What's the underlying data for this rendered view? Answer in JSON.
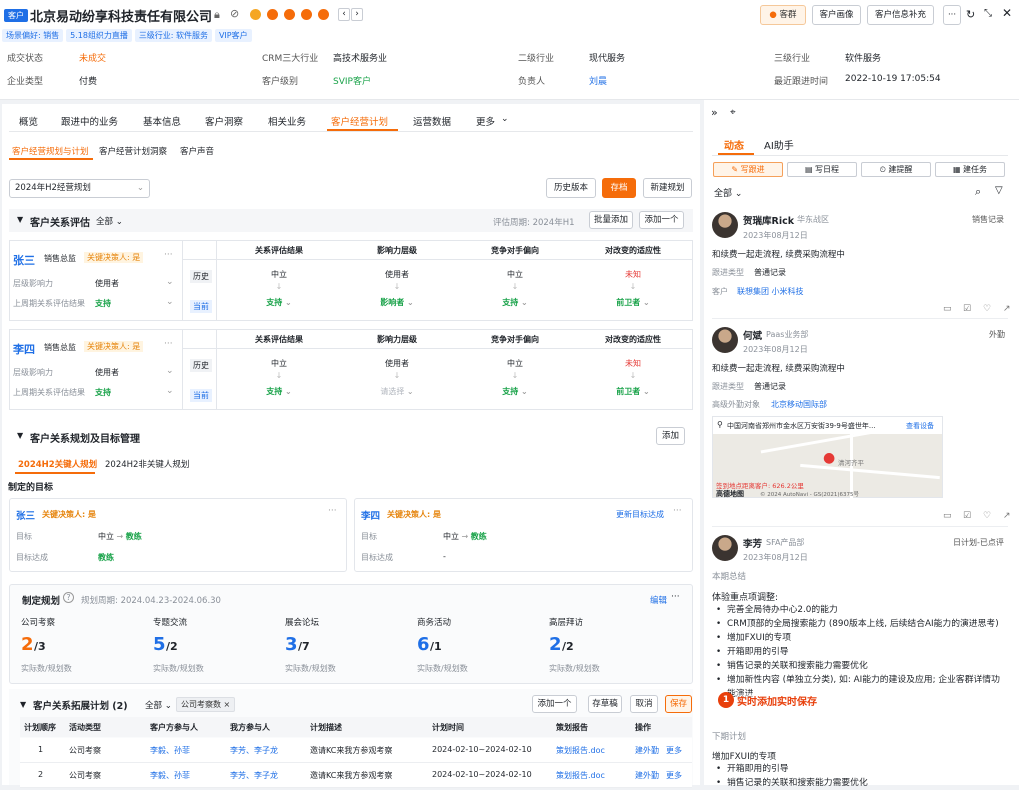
{
  "header": {
    "badge": "客户",
    "title": "北京易动纷享科技责任有限公司",
    "tags": [
      "场景偏好: 销售",
      "5.18组织力直播",
      "三级行业: 软件服务",
      "VIP客户"
    ],
    "btn_group": "客群",
    "btn_portrait": "客户画像",
    "btn_supplement": "客户信息补充"
  },
  "info": [
    {
      "label": "成交状态",
      "value": "未成交",
      "cls": "orange"
    },
    {
      "label": "CRM三大行业",
      "value": "高技术服务业",
      "cls": ""
    },
    {
      "label": "二级行业",
      "value": "现代服务",
      "cls": ""
    },
    {
      "label": "三级行业",
      "value": "软件服务",
      "cls": ""
    },
    {
      "label": "企业类型",
      "value": "付费",
      "cls": ""
    },
    {
      "label": "客户级别",
      "value": "SVIP客户",
      "cls": "green"
    },
    {
      "label": "负责人",
      "value": "刘晨",
      "cls": "blue"
    },
    {
      "label": "最近跟进时间",
      "value": "2022-10-19 17:05:54",
      "cls": ""
    }
  ],
  "tabs": [
    "概览",
    "跟进中的业务",
    "基本信息",
    "客户洞察",
    "相关业务",
    "客户经营计划",
    "运营数据",
    "更多"
  ],
  "subtabs": [
    "客户经营规划与计划",
    "客户经营计划洞察",
    "客户声音"
  ],
  "plan_select": "2024年H2经营规划",
  "toolbar": {
    "history": "历史版本",
    "save": "存档",
    "new": "新建规划"
  },
  "eval": {
    "title": "客户关系评估",
    "filter": "全部",
    "period": "评估周期: 2024年H1",
    "batch": "批量添加",
    "add": "添加一个",
    "cols": [
      "关系评估结果",
      "影响力层级",
      "竞争对手偏向",
      "对改变的适应性"
    ],
    "rows": [
      {
        "name": "张三",
        "role": "销售总监",
        "key": "关键决策人: 是",
        "f1": "层级影响力",
        "v1": "使用者",
        "f2": "上周期关系评估结果",
        "v2": "支持",
        "hist": [
          "中立",
          "使用者",
          "中立",
          "未知"
        ],
        "cur": [
          "支持",
          "影响者",
          "支持",
          "前卫者"
        ]
      },
      {
        "name": "李四",
        "role": "销售总监",
        "key": "关键决策人: 是",
        "f1": "层级影响力",
        "v1": "使用者",
        "f2": "上周期关系评估结果",
        "v2": "支持",
        "hist": [
          "中立",
          "使用者",
          "中立",
          "未知"
        ],
        "cur": [
          "支持",
          "请选择",
          "支持",
          "前卫者"
        ]
      }
    ],
    "hist_label": "历史",
    "cur_label": "当前"
  },
  "mgmt": {
    "title": "客户关系规划及目标管理",
    "add": "添加",
    "tab1": "2024H2关键人规划",
    "tab2": "2024H2非关键人规划",
    "goal_title": "制定的目标",
    "goals": [
      {
        "name": "张三",
        "key": "关键决策人: 是",
        "l1": "目标",
        "v1a": "中立",
        "v1b": "教练",
        "l2": "目标达成",
        "v2": "教练",
        "update": ""
      },
      {
        "name": "李四",
        "key": "关键决策人: 是",
        "l1": "目标",
        "v1a": "中立",
        "v1b": "教练",
        "l2": "目标达成",
        "v2": "-",
        "update": "更新目标达成"
      }
    ]
  },
  "plan": {
    "title": "制定规划",
    "period": "规划周期: 2024.04.23-2024.06.30",
    "edit": "编辑",
    "sub": "实际数/规划数",
    "stats": [
      {
        "label": "公司考察",
        "a": "2",
        "b": "/3",
        "c": "#f56c0a"
      },
      {
        "label": "专题交流",
        "a": "5",
        "b": "/2",
        "c": "#1f6fe6"
      },
      {
        "label": "展会论坛",
        "a": "3",
        "b": "/7",
        "c": "#1f6fe6"
      },
      {
        "label": "商务活动",
        "a": "6",
        "b": "/1",
        "c": "#1f6fe6"
      },
      {
        "label": "高层拜访",
        "a": "2",
        "b": "/2",
        "c": "#1f6fe6"
      }
    ]
  },
  "expand": {
    "title": "客户关系拓展计划 (2)",
    "filter": "全部",
    "chip": "公司考察数",
    "add": "添加一个",
    "draft": "存草稿",
    "cancel": "取消",
    "save": "保存",
    "cols": [
      "计划顺序",
      "活动类型",
      "客户方参与人",
      "我方参与人",
      "计划描述",
      "计划时间",
      "策划报告",
      "操作"
    ],
    "rows": [
      {
        "n": "1",
        "type": "公司考察",
        "cust": "李毅、孙菲",
        "our": "李芳、李子龙",
        "desc": "邀请KC来我方参观考察",
        "time": "2024-02-10~2024-02-10",
        "doc": "策划报告.doc",
        "op1": "建外勤",
        "op2": "更多"
      },
      {
        "n": "2",
        "type": "公司考察",
        "cust": "李毅、孙菲",
        "our": "李芳、李子龙",
        "desc": "邀请KC来我方参观考察",
        "time": "2024-02-10~2024-02-10",
        "doc": "策划报告.doc",
        "op1": "建外勤",
        "op2": "更多"
      }
    ]
  },
  "right": {
    "tab1": "动态",
    "tab2": "AI助手",
    "actions": [
      "写跟进",
      "写日程",
      "建提醒",
      "建任务"
    ],
    "filter": "全部",
    "feed": [
      {
        "name": "贺瑞库Rick",
        "dept": "华东战区",
        "type": "销售记录",
        "date": "2023年08月12日",
        "text": "和续费一起走流程, 续费采购流程中",
        "k1": "跟进类型",
        "v1": "普通记录",
        "k2": "客户",
        "v2": "联想集团  小米科技"
      },
      {
        "name": "何斌",
        "dept": "Paas业务部",
        "type": "外勤",
        "date": "2023年08月12日",
        "text": "和续费一起走流程, 续费采购流程中",
        "k1": "跟进类型",
        "v1": "普通记录",
        "k2": "高级外勤对象",
        "v2": "北京移动国际部",
        "addr": "中国河南省郑州市金水区万安街39-9号盛世年...",
        "view": "查看设备",
        "map_note": "签到地点距离客户: 626.2公里",
        "map_place": "清河齐平",
        "map_brand": "高德地图",
        "map_copy": "© 2024 AutoNavi - GS(2021)6375号"
      },
      {
        "name": "李芳",
        "dept": "SFA产品部",
        "type": "日计划-已点评",
        "date": "2023年08月12日",
        "summary": "本期总结",
        "head": "体验重点项调整:",
        "bullets": [
          "完善全局待办中心2.0的能力",
          "CRM顶部的全局搜索能力 (890版本上线, 后续结合AI能力的演进思考)",
          "增加FXUI的专项",
          "开箱即用的引导",
          "销售记录的关联和搜索能力需要优化",
          "增加新性内容 (单独立分类), 如: AI能力的建设及应用; 企业客群详情功能演进"
        ],
        "next": "下期计划",
        "next_head": "增加FXUI的专项",
        "next_bullets": [
          "开箱即用的引导",
          "销售记录的关联和搜索能力需要优化"
        ],
        "badge": "1",
        "badge_text": "实时添加实时保存"
      }
    ]
  }
}
